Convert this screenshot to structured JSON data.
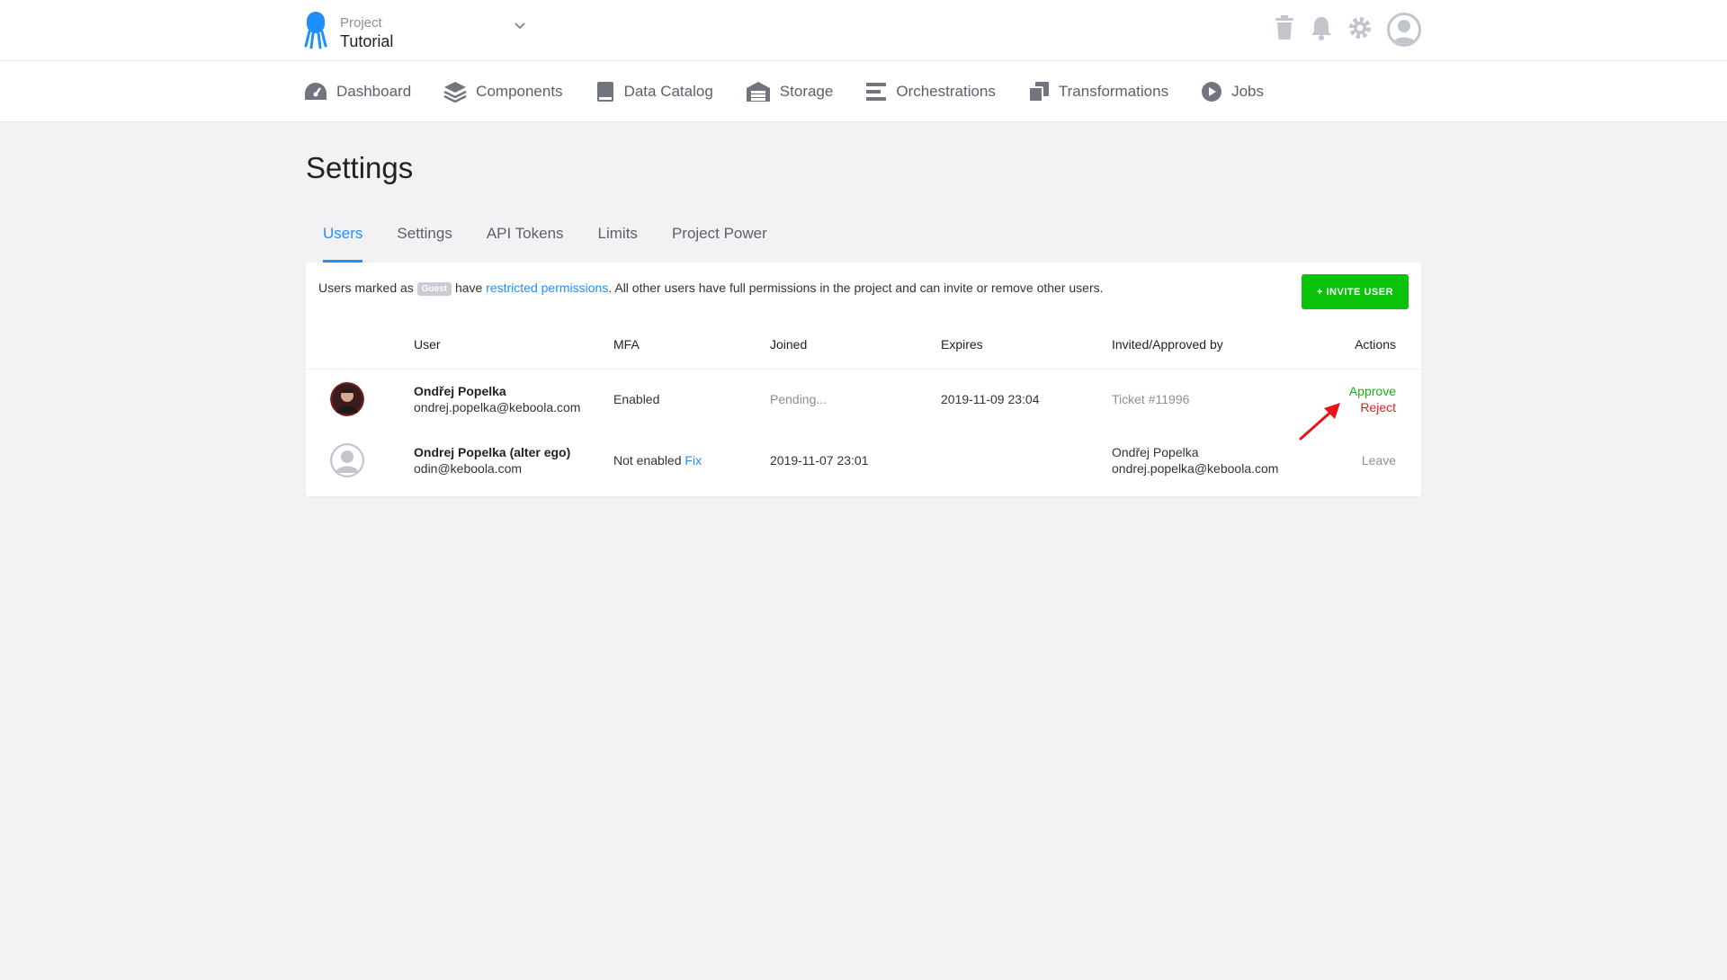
{
  "project": {
    "label": "Project",
    "name": "Tutorial"
  },
  "nav": [
    {
      "label": "Dashboard",
      "icon": "dashboard-icon"
    },
    {
      "label": "Components",
      "icon": "layers-icon"
    },
    {
      "label": "Data Catalog",
      "icon": "book-icon"
    },
    {
      "label": "Storage",
      "icon": "warehouse-icon"
    },
    {
      "label": "Orchestrations",
      "icon": "bars-icon"
    },
    {
      "label": "Transformations",
      "icon": "copy-icon"
    },
    {
      "label": "Jobs",
      "icon": "play-circle-icon"
    }
  ],
  "page": {
    "title": "Settings"
  },
  "tabs": [
    "Users",
    "Settings",
    "API Tokens",
    "Limits",
    "Project Power"
  ],
  "info": {
    "prefix": "Users marked as",
    "badge": "Guest",
    "mid": "have",
    "link": "restricted permissions",
    "suffix": ". All other users have full permissions in the project and can invite or remove other users."
  },
  "invite_label": "+ INVITE USER",
  "table": {
    "headers": {
      "user": "User",
      "mfa": "MFA",
      "joined": "Joined",
      "expires": "Expires",
      "invited": "Invited/Approved by",
      "actions": "Actions"
    },
    "rows": [
      {
        "name": "Ondřej Popelka",
        "email": "ondrej.popelka@keboola.com",
        "mfa": "Enabled",
        "joined": "Pending...",
        "expires": "2019-11-09 23:04",
        "invited": "Ticket #11996",
        "approve": "Approve",
        "reject": "Reject"
      },
      {
        "name": "Ondrej Popelka (alter ego)",
        "email": "odin@keboola.com",
        "mfa": "Not enabled",
        "mfa_fix": "Fix",
        "joined": "2019-11-07 23:01",
        "expires": "",
        "invited_name": "Ondřej Popelka",
        "invited_email": "ondrej.popelka@keboola.com",
        "leave": "Leave"
      }
    ]
  },
  "colors": {
    "accent": "#1f8fff",
    "primary_button": "#0bc20b",
    "approve": "#11b511",
    "reject": "#e0202c",
    "annotation_arrow": "#e8141c"
  }
}
